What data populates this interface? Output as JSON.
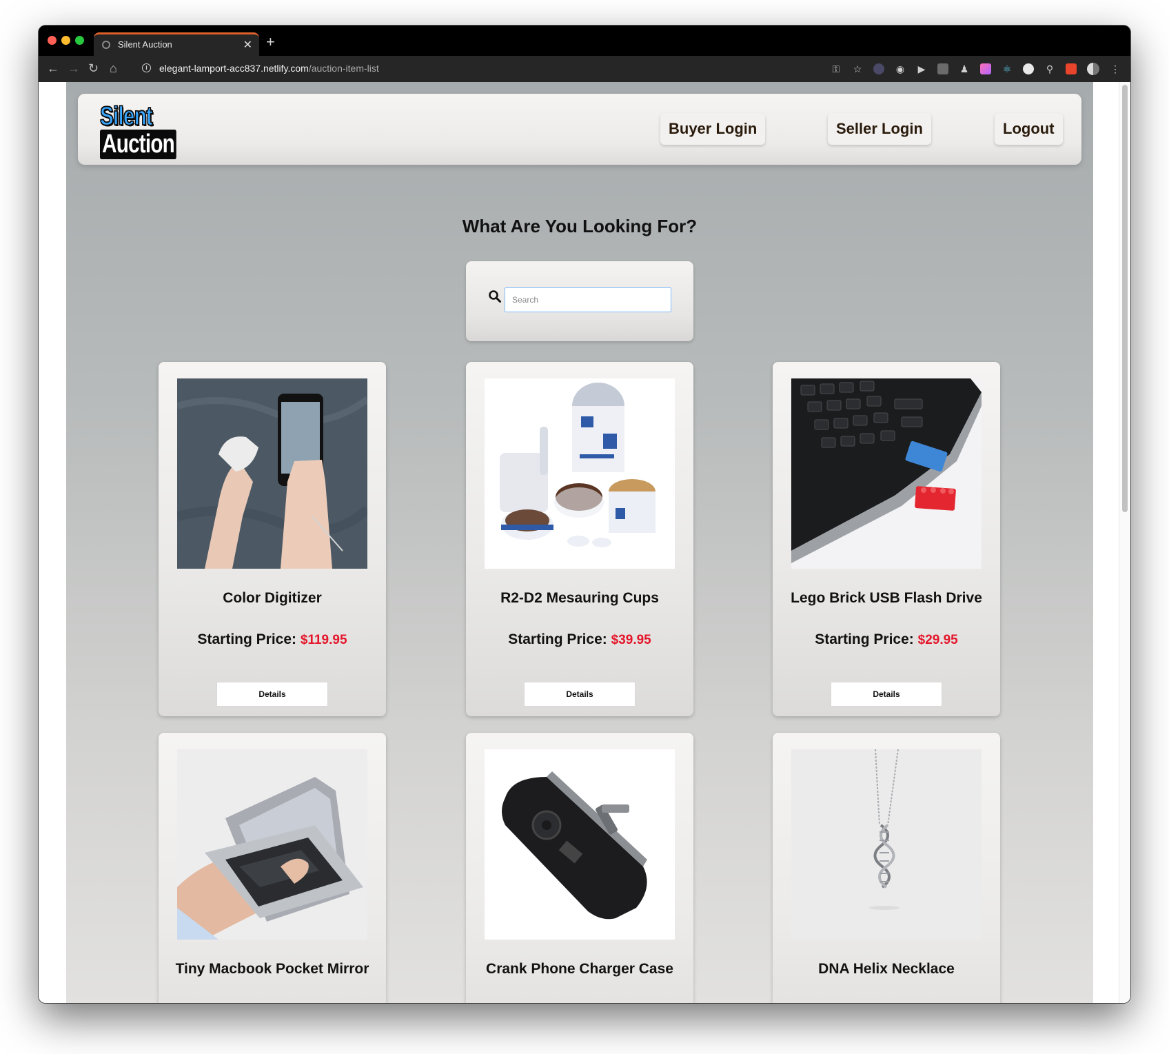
{
  "browser": {
    "tab_title": "Silent Auction",
    "url_host": "elegant-lamport-acc837.netlify.com",
    "url_path": "/auction-item-list"
  },
  "header": {
    "logo_line1": "Silent",
    "logo_line2": "Auction",
    "nav": {
      "buyer_login": "Buyer Login",
      "seller_login": "Seller Login",
      "logout": "Logout"
    }
  },
  "main": {
    "heading": "What Are You Looking For?",
    "search": {
      "placeholder": "Search",
      "value": ""
    },
    "price_label": "Starting Price:",
    "details_label": "Details",
    "items": [
      {
        "name": "Color Digitizer",
        "price": "$119.95",
        "image": "color-digitizer-photo"
      },
      {
        "name": "R2-D2 Mesauring Cups",
        "price": "$39.95",
        "image": "r2d2-measuring-cups-photo"
      },
      {
        "name": "Lego Brick USB Flash Drive",
        "price": "$29.95",
        "image": "lego-usb-drive-photo"
      },
      {
        "name": "Tiny Macbook Pocket Mirror",
        "image": "macbook-mirror-photo"
      },
      {
        "name": "Crank Phone Charger Case",
        "image": "crank-charger-photo"
      },
      {
        "name": "DNA Helix Necklace",
        "image": "dna-necklace-photo"
      }
    ]
  },
  "colors": {
    "accent_tab": "#e0622a",
    "price_red": "#e5162b",
    "logo_blue": "#3aa7ff",
    "search_focus": "#80bdff"
  }
}
